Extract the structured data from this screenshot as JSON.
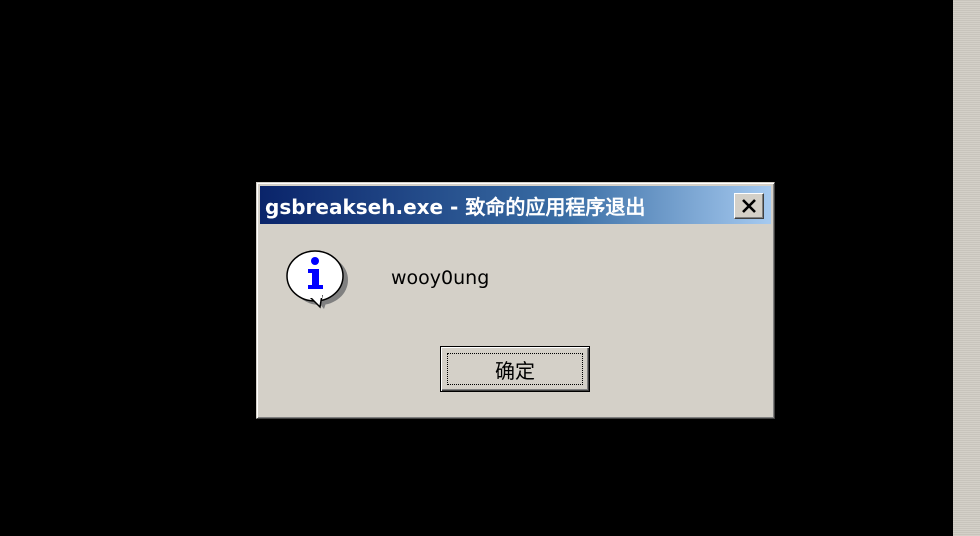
{
  "dialog": {
    "title": "gsbreakseh.exe - 致命的应用程序退出",
    "message": "wooy0ung",
    "ok_label": "确定",
    "icon": "information-icon",
    "close_icon": "close-icon"
  },
  "colors": {
    "desktop": "#000000",
    "dialog_face": "#d4d0c8",
    "titlebar_start": "#0a246a",
    "titlebar_end": "#a6caf0",
    "title_text": "#ffffff",
    "icon_blue": "#0000ff"
  }
}
